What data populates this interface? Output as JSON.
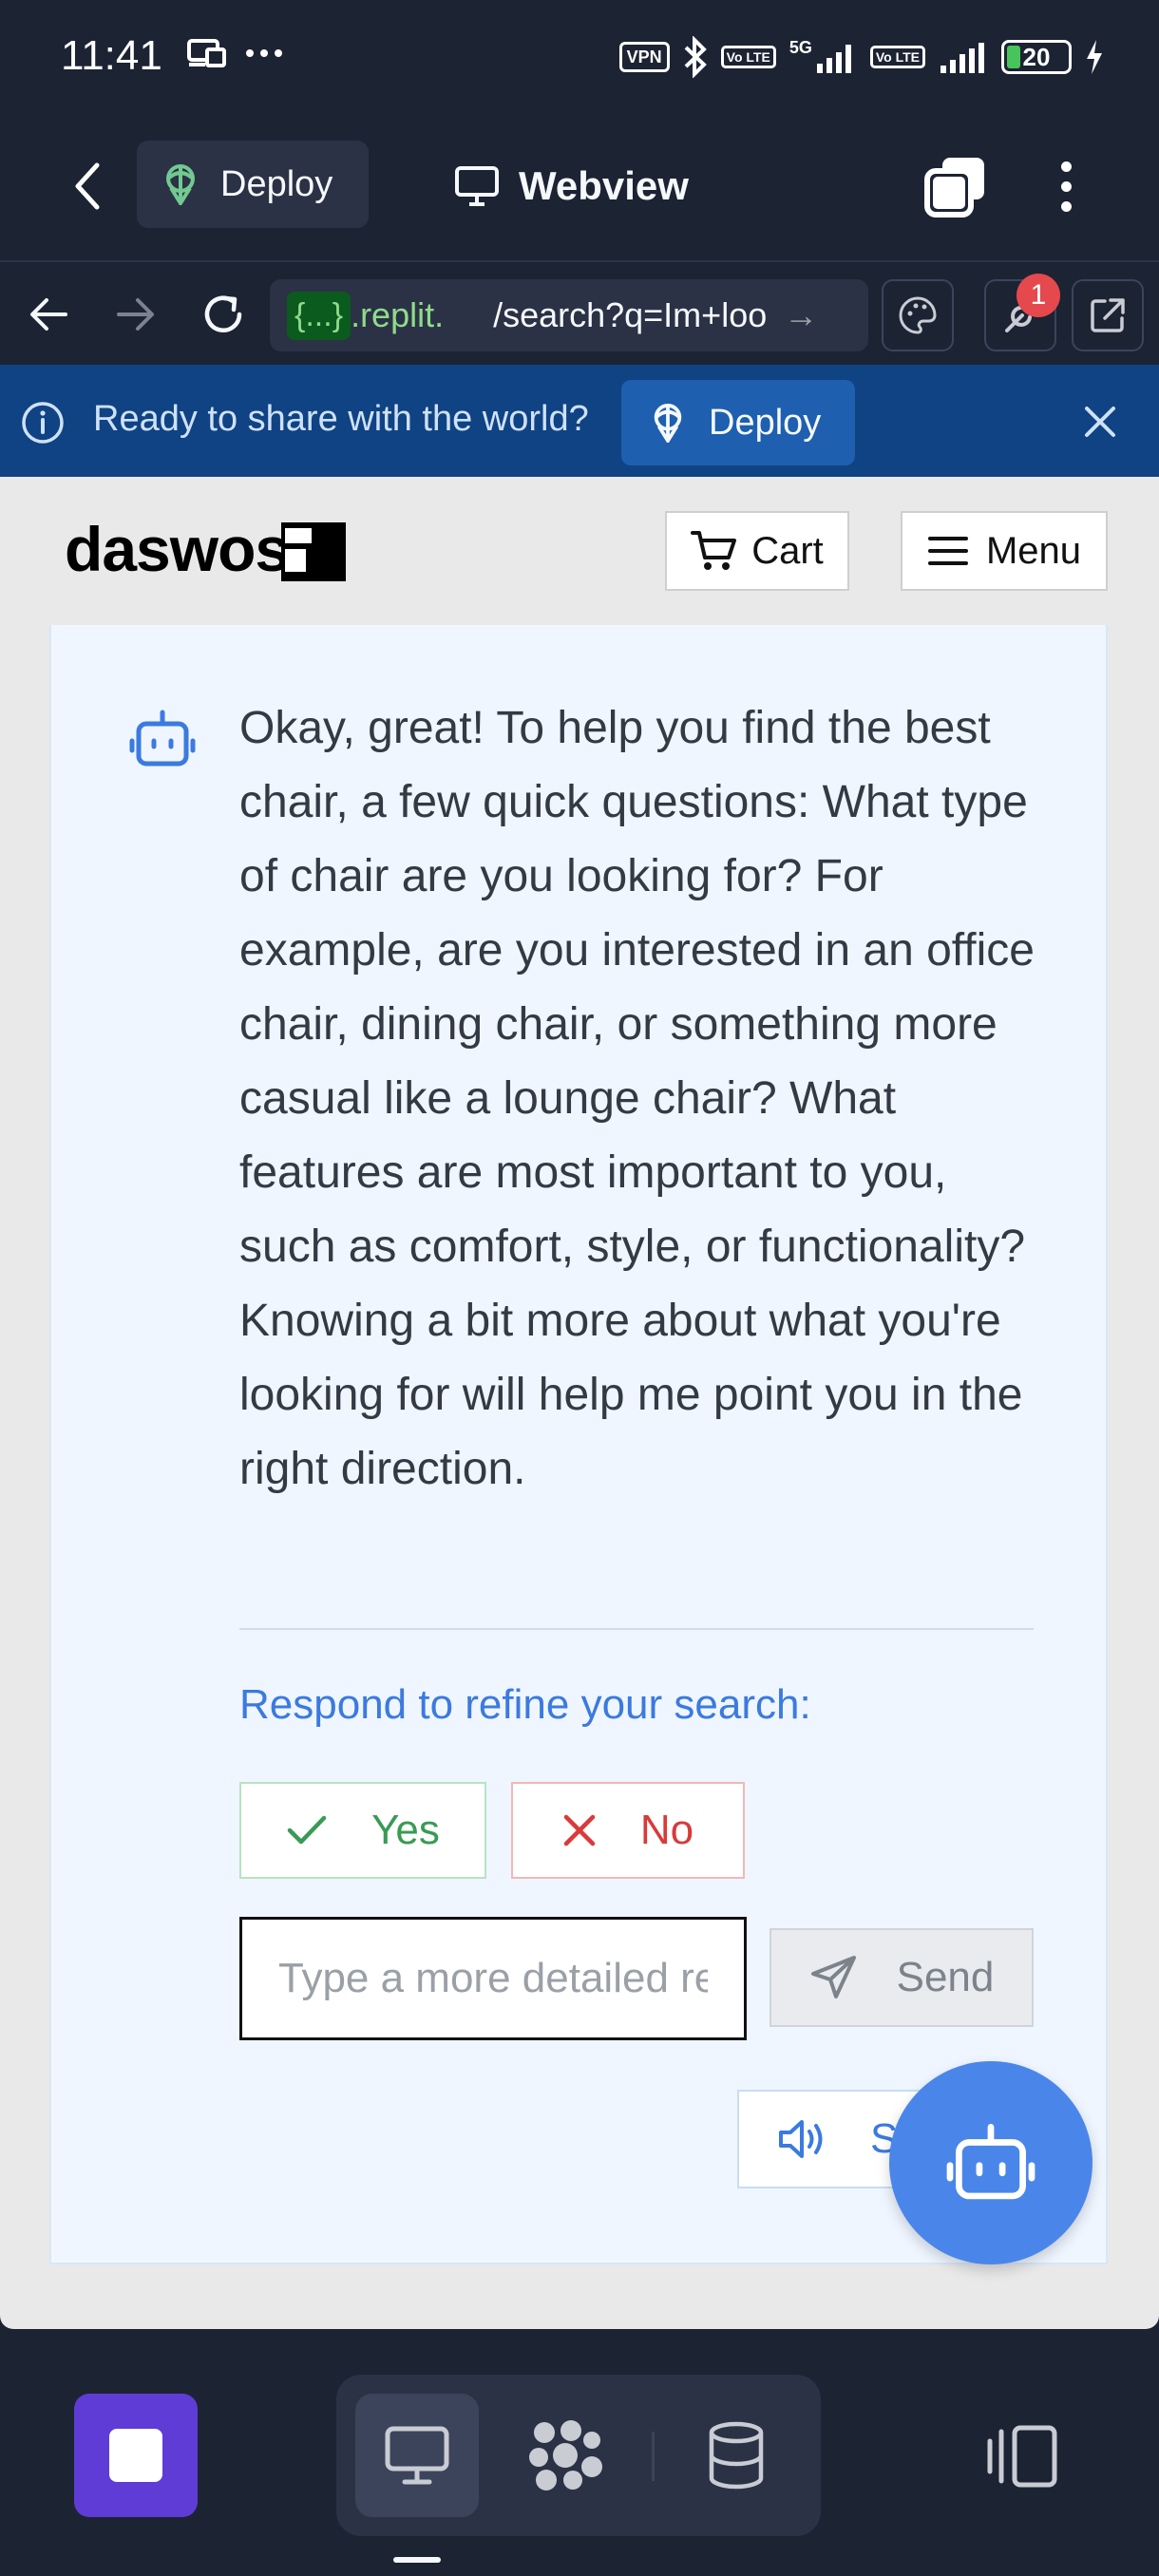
{
  "status_bar": {
    "time": "11:41",
    "vpn": "VPN",
    "net_5g": "5G",
    "volte1": "Vo LTE",
    "volte2": "Vo LTE",
    "battery": "20",
    "battery_level": 0.2
  },
  "header": {
    "deploy_label": "Deploy",
    "webview_label": "Webview"
  },
  "url_bar": {
    "chip": "{...}",
    "host": ".replit.",
    "path": "/search?q=Im+loo",
    "notification_count": "1"
  },
  "banner": {
    "text": "Ready to share with the world?",
    "deploy_label": "Deploy"
  },
  "site": {
    "logo": "daswos",
    "cart_label": "Cart",
    "menu_label": "Menu"
  },
  "chat": {
    "message": "Okay, great! To help you find the best chair, a few quick questions: What type of chair are you looking for? For example, are you interested in an office chair, dining chair, or something more casual like a lounge chair? What features are most important to you, such as comfort, style, or functionality? Knowing a bit more about what you're looking for will help me point you in the right direction.",
    "refine_label": "Respond to refine your search:",
    "yes_label": "Yes",
    "no_label": "No",
    "input_placeholder": "Type a more detailed response...",
    "send_label": "Send",
    "speak_label": "S"
  },
  "colors": {
    "chrome_bg": "#1c2333",
    "banner_bg": "#0f4383",
    "accent_blue": "#3b7ae0",
    "fab_blue": "#4a86ea",
    "yes_green": "#3a9a55",
    "no_red": "#d93a3a",
    "stop_purple": "#5f3cd6"
  },
  "icons": [
    "chevron-left-icon",
    "deploy-icon",
    "monitor-icon",
    "tabs-icon",
    "more-vertical-icon",
    "arrow-left-icon",
    "arrow-right-icon",
    "reload-icon",
    "palette-icon",
    "wrench-icon",
    "external-link-icon",
    "info-icon",
    "close-icon",
    "cart-icon",
    "hamburger-icon",
    "robot-icon",
    "check-icon",
    "x-icon",
    "send-icon",
    "speaker-icon",
    "stop-icon",
    "database-icon",
    "panel-icon"
  ]
}
